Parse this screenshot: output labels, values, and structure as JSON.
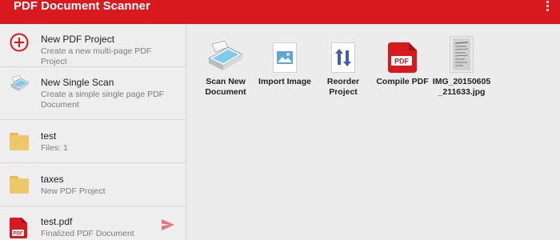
{
  "app": {
    "title": "PDF Document Scanner",
    "accent_color": "#d8191e",
    "overflow_icon": "more-vert-icon"
  },
  "sidebar": {
    "items": [
      {
        "title": "New PDF Project",
        "subtitle": "Create a new multi-page PDF Project",
        "icon": "add-circle-icon"
      },
      {
        "title": "New Single Scan",
        "subtitle": "Create a simple single page PDF Document",
        "icon": "scanner-icon"
      },
      {
        "title": "test",
        "subtitle": "Files: 1",
        "icon": "folder-icon"
      },
      {
        "title": "taxes",
        "subtitle": "New PDF Project",
        "icon": "folder-icon"
      },
      {
        "title": "test.pdf",
        "subtitle": "Finalized PDF Document",
        "icon": "pdf-file-icon",
        "action_icon": "send-icon"
      }
    ]
  },
  "main": {
    "tiles": [
      {
        "label": "Scan New Document",
        "icon": "scanner-icon"
      },
      {
        "label": "Import Image",
        "icon": "image-icon"
      },
      {
        "label": "Reorder Project",
        "icon": "reorder-arrows-icon"
      },
      {
        "label": "Compile PDF",
        "icon": "pdf-icon"
      },
      {
        "label": "IMG_20150605_211633.jpg",
        "icon": "document-thumbnail-icon"
      }
    ]
  }
}
